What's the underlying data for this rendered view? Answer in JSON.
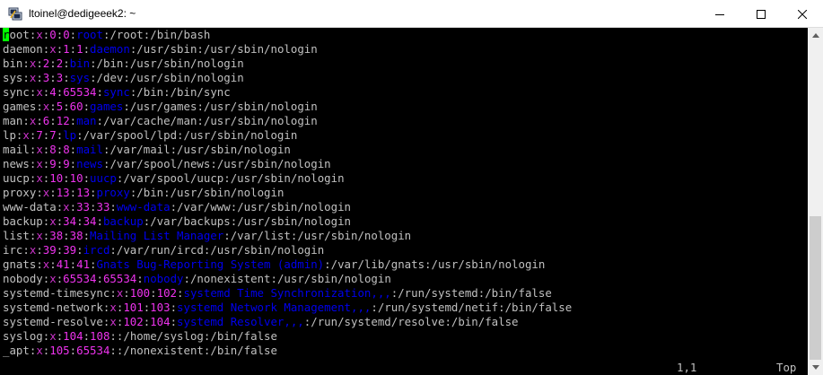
{
  "window": {
    "title": "ltoinel@dedigeeek2: ~",
    "icon": "putty-icon"
  },
  "colors": {
    "background": "#000000",
    "text": "#c0c0c0",
    "cursor": "#00ff00",
    "field_x": "#cc33cc",
    "field_num": "#ee33ee",
    "field_gecos": "#0000ee"
  },
  "lines": [
    {
      "user": "root",
      "x": "x",
      "uid": "0",
      "gid": "0",
      "gecos": "root",
      "home": "/root",
      "shell": "/bin/bash"
    },
    {
      "user": "daemon",
      "x": "x",
      "uid": "1",
      "gid": "1",
      "gecos": "daemon",
      "home": "/usr/sbin",
      "shell": "/usr/sbin/nologin"
    },
    {
      "user": "bin",
      "x": "x",
      "uid": "2",
      "gid": "2",
      "gecos": "bin",
      "home": "/bin",
      "shell": "/usr/sbin/nologin"
    },
    {
      "user": "sys",
      "x": "x",
      "uid": "3",
      "gid": "3",
      "gecos": "sys",
      "home": "/dev",
      "shell": "/usr/sbin/nologin"
    },
    {
      "user": "sync",
      "x": "x",
      "uid": "4",
      "gid": "65534",
      "gecos": "sync",
      "home": "/bin",
      "shell": "/bin/sync"
    },
    {
      "user": "games",
      "x": "x",
      "uid": "5",
      "gid": "60",
      "gecos": "games",
      "home": "/usr/games",
      "shell": "/usr/sbin/nologin"
    },
    {
      "user": "man",
      "x": "x",
      "uid": "6",
      "gid": "12",
      "gecos": "man",
      "home": "/var/cache/man",
      "shell": "/usr/sbin/nologin"
    },
    {
      "user": "lp",
      "x": "x",
      "uid": "7",
      "gid": "7",
      "gecos": "lp",
      "home": "/var/spool/lpd",
      "shell": "/usr/sbin/nologin"
    },
    {
      "user": "mail",
      "x": "x",
      "uid": "8",
      "gid": "8",
      "gecos": "mail",
      "home": "/var/mail",
      "shell": "/usr/sbin/nologin"
    },
    {
      "user": "news",
      "x": "x",
      "uid": "9",
      "gid": "9",
      "gecos": "news",
      "home": "/var/spool/news",
      "shell": "/usr/sbin/nologin"
    },
    {
      "user": "uucp",
      "x": "x",
      "uid": "10",
      "gid": "10",
      "gecos": "uucp",
      "home": "/var/spool/uucp",
      "shell": "/usr/sbin/nologin"
    },
    {
      "user": "proxy",
      "x": "x",
      "uid": "13",
      "gid": "13",
      "gecos": "proxy",
      "home": "/bin",
      "shell": "/usr/sbin/nologin"
    },
    {
      "user": "www-data",
      "x": "x",
      "uid": "33",
      "gid": "33",
      "gecos": "www-data",
      "home": "/var/www",
      "shell": "/usr/sbin/nologin"
    },
    {
      "user": "backup",
      "x": "x",
      "uid": "34",
      "gid": "34",
      "gecos": "backup",
      "home": "/var/backups",
      "shell": "/usr/sbin/nologin"
    },
    {
      "user": "list",
      "x": "x",
      "uid": "38",
      "gid": "38",
      "gecos": "Mailing List Manager",
      "home": "/var/list",
      "shell": "/usr/sbin/nologin"
    },
    {
      "user": "irc",
      "x": "x",
      "uid": "39",
      "gid": "39",
      "gecos": "ircd",
      "home": "/var/run/ircd",
      "shell": "/usr/sbin/nologin"
    },
    {
      "user": "gnats",
      "x": "x",
      "uid": "41",
      "gid": "41",
      "gecos": "Gnats Bug-Reporting System (admin)",
      "home": "/var/lib/gnats",
      "shell": "/usr/sbin/nologin"
    },
    {
      "user": "nobody",
      "x": "x",
      "uid": "65534",
      "gid": "65534",
      "gecos": "nobody",
      "home": "/nonexistent",
      "shell": "/usr/sbin/nologin"
    },
    {
      "user": "systemd-timesync",
      "x": "x",
      "uid": "100",
      "gid": "102",
      "gecos": "systemd Time Synchronization,,,",
      "home": "/run/systemd",
      "shell": "/bin/false"
    },
    {
      "user": "systemd-network",
      "x": "x",
      "uid": "101",
      "gid": "103",
      "gecos": "systemd Network Management,,,",
      "home": "/run/systemd/netif",
      "shell": "/bin/false"
    },
    {
      "user": "systemd-resolve",
      "x": "x",
      "uid": "102",
      "gid": "104",
      "gecos": "systemd Resolver,,,",
      "home": "/run/systemd/resolve",
      "shell": "/bin/false"
    },
    {
      "user": "syslog",
      "x": "x",
      "uid": "104",
      "gid": "108",
      "gecos": "",
      "home": "/home/syslog",
      "shell": "/bin/false"
    },
    {
      "user": "_apt",
      "x": "x",
      "uid": "105",
      "gid": "65534",
      "gecos": "",
      "home": "/nonexistent",
      "shell": "/bin/false"
    }
  ],
  "statusbar": {
    "position": "1,1",
    "scroll": "Top"
  }
}
